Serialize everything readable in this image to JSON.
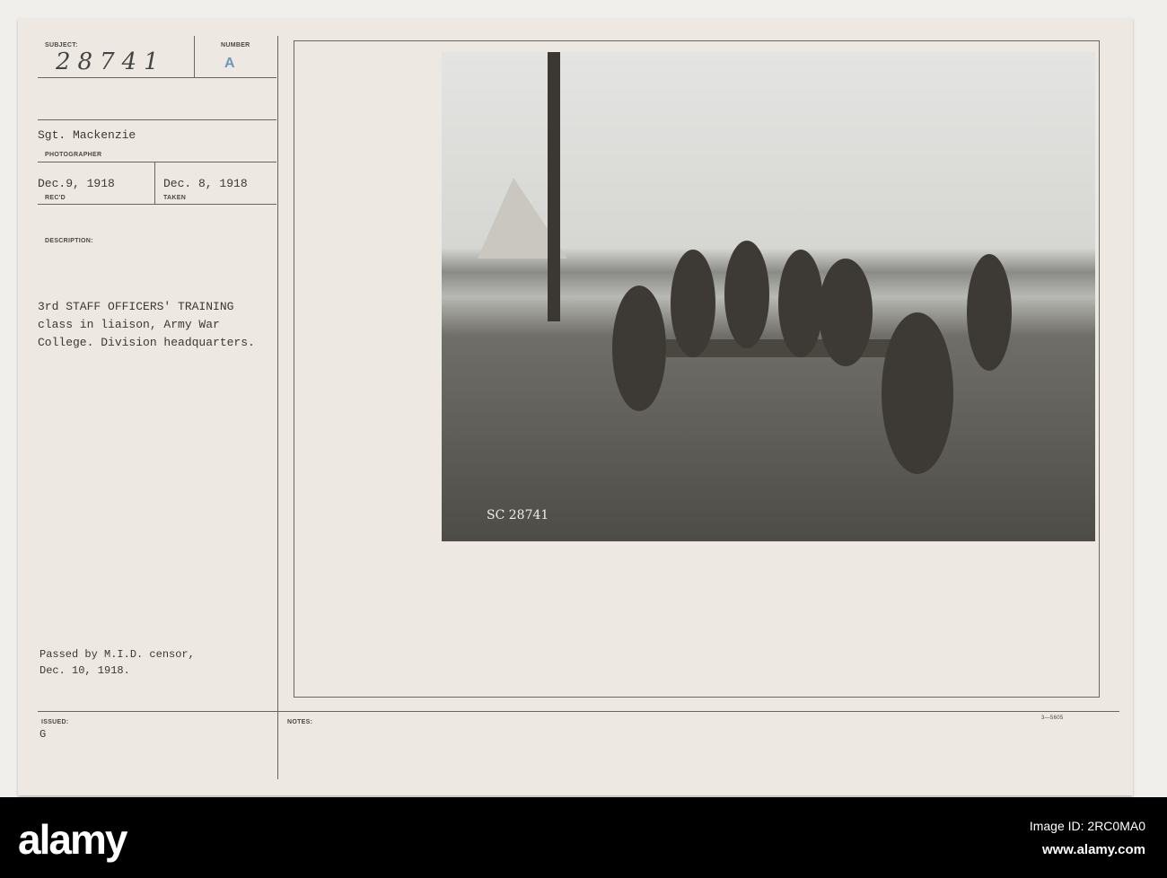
{
  "card": {
    "subject_label": "SUBJECT:",
    "subject_value": "28741",
    "number_label": "NUMBER",
    "number_value": "A",
    "photographer_value": "Sgt. Mackenzie",
    "photographer_label": "PHOTOGRAPHER",
    "received_value": "Dec.9, 1918",
    "received_label": "REC'D",
    "taken_value": "Dec. 8, 1918",
    "taken_label": "TAKEN",
    "description_label": "DESCRIPTION:",
    "description_text": "3rd STAFF OFFICERS' TRAINING\nclass in liaison, Army War\nCollege. Division headquarters.",
    "censor_text": "Passed by M.I.D. censor,\nDec. 10, 1918.",
    "issued_label": "ISSUED:",
    "issued_value": "G",
    "notes_label": "NOTES:",
    "form_number": "3—5605",
    "photo_caption": "SC 28741"
  },
  "footer": {
    "logo": "alamy",
    "image_id": "Image ID: 2RC0MA0",
    "url": "www.alamy.com"
  }
}
